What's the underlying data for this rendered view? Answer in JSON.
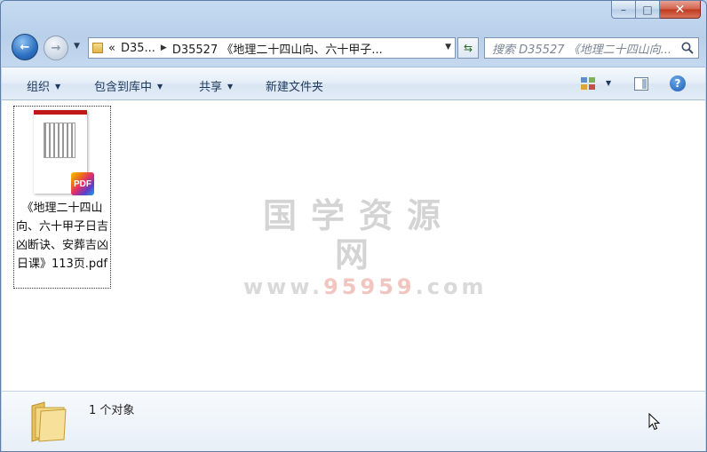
{
  "window": {
    "caption_buttons": {
      "minimize": "–",
      "maximize": "□",
      "close": "✕"
    }
  },
  "nav": {
    "back_glyph": "←",
    "forward_glyph": "→",
    "breadcrumb": {
      "overflow": "«",
      "items": [
        "D35...",
        "D35527 《地理二十四山向、六十甲子..."
      ]
    },
    "search_placeholder": "搜索 D35527 《地理二十四山向..."
  },
  "toolbar": {
    "organize": "组织",
    "include_in_library": "包含到库中",
    "share": "共享",
    "new_folder": "新建文件夹",
    "help_glyph": "?"
  },
  "files": [
    {
      "name": "《地理二十四山向、六十甲子日吉凶断诀、安葬吉凶日课》113页.pdf",
      "badge": "PDF",
      "thumb_header": "PDF"
    }
  ],
  "watermark": {
    "main": "国学资源网",
    "sub_prefix": "www.",
    "sub_highlight": "95959",
    "sub_suffix": ".com"
  },
  "status": {
    "item_count": "1 个对象"
  }
}
